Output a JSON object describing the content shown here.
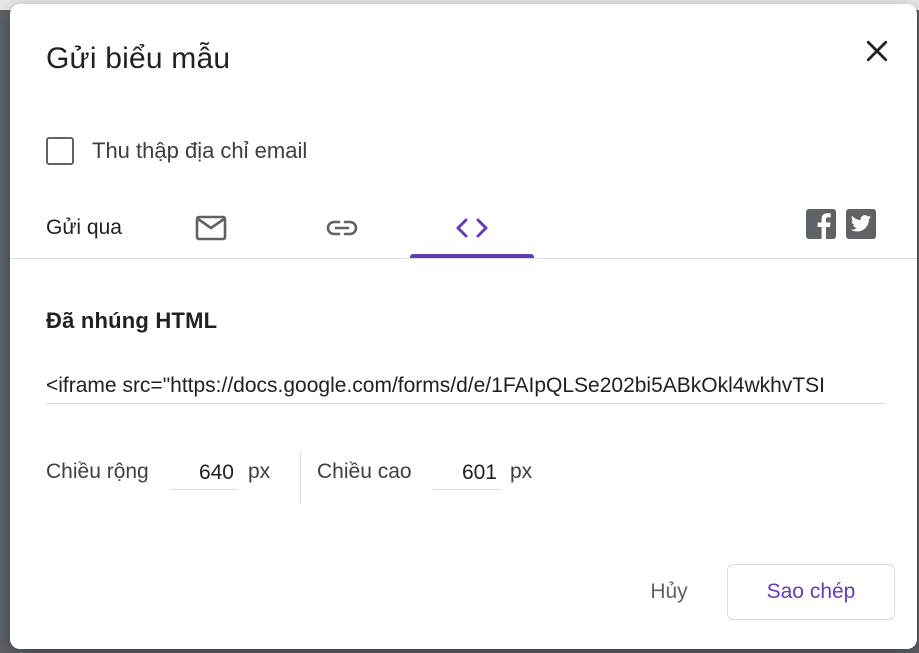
{
  "dialog": {
    "title": "Gửi biểu mẫu",
    "close_icon": "close-icon"
  },
  "collect_email": {
    "label": "Thu thập địa chỉ email",
    "checked": false
  },
  "send_via": {
    "label": "Gửi qua",
    "tabs": [
      {
        "name": "email",
        "icon": "email-icon",
        "selected": false
      },
      {
        "name": "link",
        "icon": "link-icon",
        "selected": false
      },
      {
        "name": "embed",
        "icon": "code-icon",
        "selected": true
      }
    ],
    "social": [
      "facebook-icon",
      "twitter-icon"
    ]
  },
  "embed": {
    "section_title": "Đã nhúng HTML",
    "code": "<iframe src=\"https://docs.google.com/forms/d/e/1FAIpQLSe202bi5ABkOkl4wkhvTSI",
    "width_label": "Chiều rộng",
    "width_value": "640",
    "height_label": "Chiều cao",
    "height_value": "601",
    "unit": "px"
  },
  "actions": {
    "cancel_label": "Hủy",
    "copy_label": "Sao chép"
  },
  "colors": {
    "accent": "#673ab7",
    "icon_gray": "#5f6368",
    "divider": "#dadce0"
  }
}
